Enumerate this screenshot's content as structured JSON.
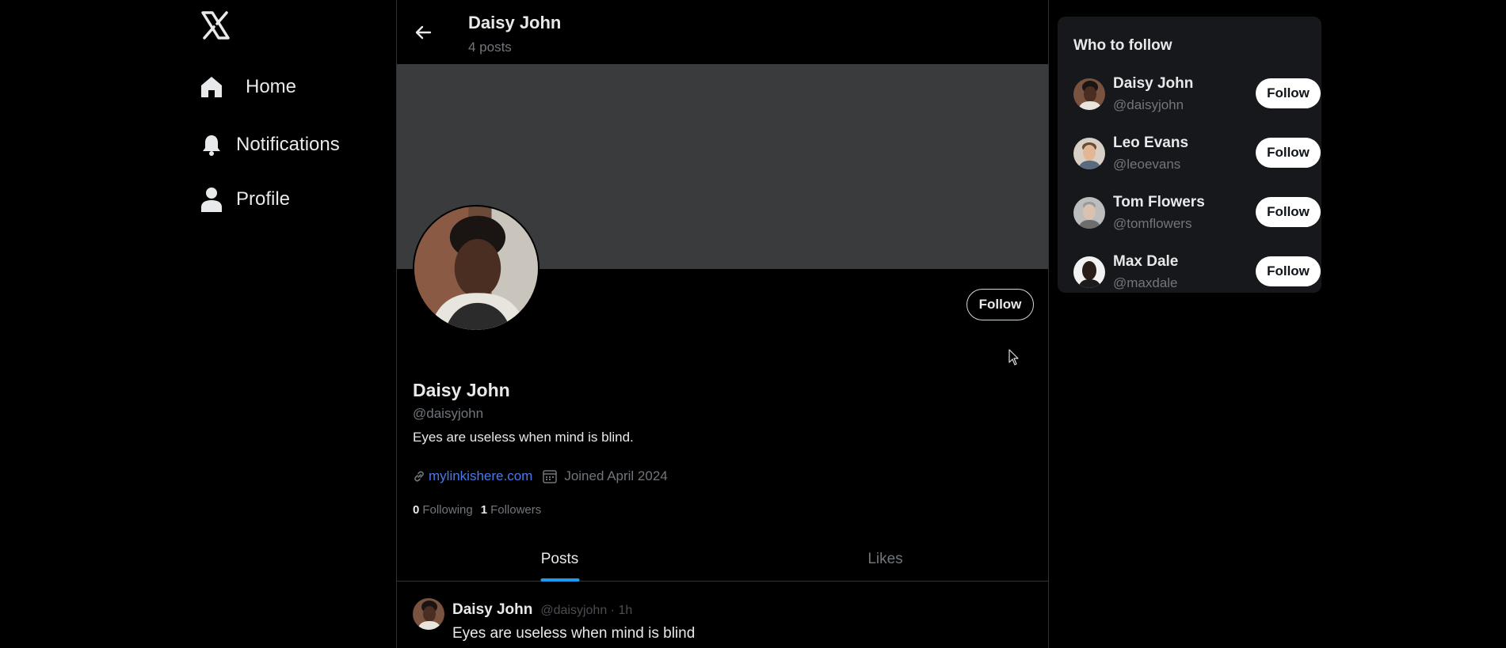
{
  "nav": {
    "logo_icon": "x-logo-icon",
    "items": [
      {
        "label": "Home",
        "icon": "home-icon"
      },
      {
        "label": "Notifications",
        "icon": "bell-icon"
      },
      {
        "label": "Profile",
        "icon": "person-icon"
      }
    ]
  },
  "header": {
    "name": "Daisy John",
    "posts_count": "4 posts"
  },
  "profile": {
    "name": "Daisy John",
    "handle": "@daisyjohn",
    "bio": "Eyes are useless when mind is blind.",
    "link": "mylinkishere.com",
    "joined": "Joined April 2024",
    "following_count": "0",
    "following_label": "Following",
    "followers_count": "1",
    "followers_label": "Followers",
    "follow_label": "Follow"
  },
  "tabs": [
    {
      "label": "Posts",
      "active": true
    },
    {
      "label": "Likes",
      "active": false
    }
  ],
  "post": {
    "name": "Daisy John",
    "meta": "@daisyjohn · 1h",
    "text": "Eyes are useless when mind is blind"
  },
  "who_to_follow": {
    "title": "Who to follow",
    "users": [
      {
        "name": "Daisy John",
        "handle": "@daisyjohn",
        "button": "Follow"
      },
      {
        "name": "Leo Evans",
        "handle": "@leoevans",
        "button": "Follow"
      },
      {
        "name": "Tom Flowers",
        "handle": "@tomflowers",
        "button": "Follow"
      },
      {
        "name": "Max Dale",
        "handle": "@maxdale",
        "button": "Follow"
      }
    ]
  },
  "colors": {
    "background": "#000000",
    "banner": "#3a3b3d",
    "link": "#4a7ae8",
    "tab_indicator": "#1d9bf0",
    "muted": "#71767b",
    "card": "#16181c"
  }
}
